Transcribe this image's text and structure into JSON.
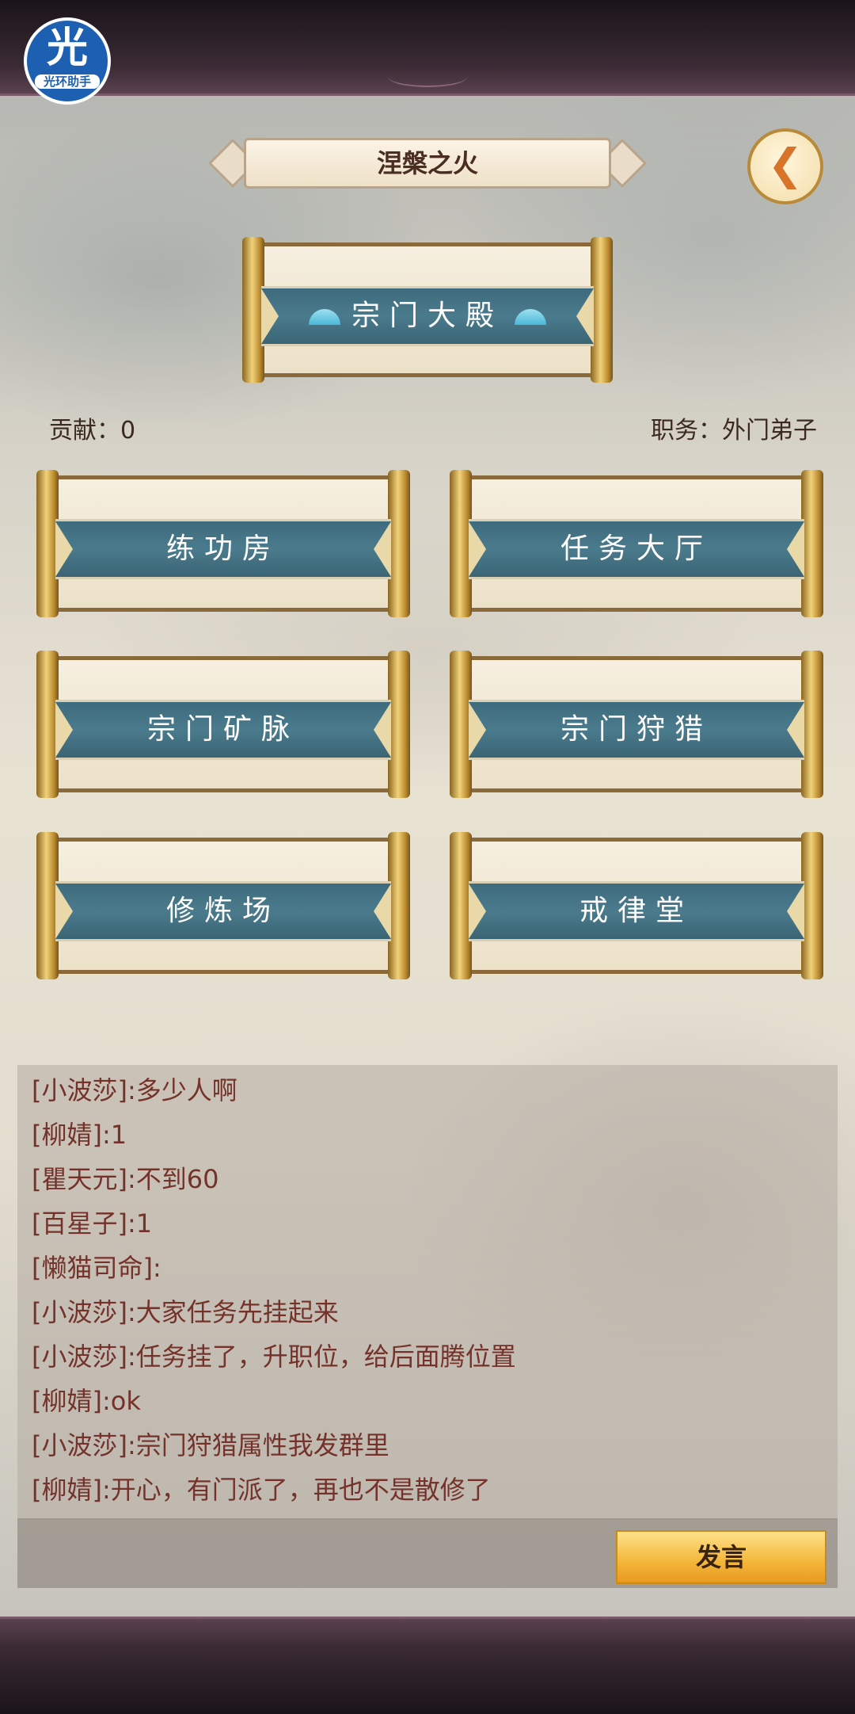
{
  "logo": {
    "main": "光",
    "sub": "光环助手"
  },
  "header": {
    "title": "涅槃之火",
    "back_icon": "back-arrow-icon"
  },
  "hall": {
    "label": "宗门大殿"
  },
  "stats": {
    "contribution": "贡献：0",
    "position": "职务：外门弟子"
  },
  "menu": [
    {
      "label": "练功房"
    },
    {
      "label": "任务大厅"
    },
    {
      "label": "宗门矿脉"
    },
    {
      "label": "宗门狩猎"
    },
    {
      "label": "修炼场"
    },
    {
      "label": "戒律堂"
    }
  ],
  "chat": {
    "messages": [
      "[小波莎]:多少人啊",
      "[柳婧]:1",
      "[瞿天元]:不到60",
      "[百星子]:1",
      "[懒猫司命]:",
      "[小波莎]:大家任务先挂起来",
      "[小波莎]:任务挂了，升职位，给后面腾位置",
      "[柳婧]:ok",
      "[小波莎]:宗门狩猎属性我发群里",
      "[柳婧]:开心，有门派了，再也不是散修了"
    ],
    "input_value": "",
    "send_label": "发言"
  },
  "colors": {
    "band": "#4a7b8c",
    "chat_text": "#74322a",
    "send": "#f3b63a"
  }
}
